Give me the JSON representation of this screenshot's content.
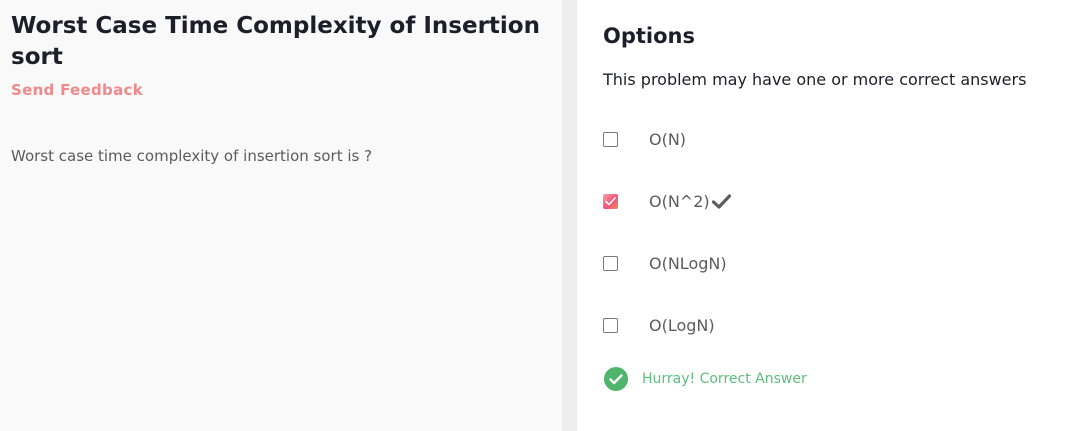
{
  "problem": {
    "title": "Worst Case Time Complexity of Insertion sort",
    "feedback_label": "Send Feedback",
    "question": "Worst case time complexity of insertion sort is ?"
  },
  "options_panel": {
    "heading": "Options",
    "note": "This problem may have one or more correct answers",
    "options": [
      {
        "label": "O(N)",
        "checked": false
      },
      {
        "label": "O(N^2)",
        "checked": true,
        "marked_correct": true
      },
      {
        "label": "O(NLogN)",
        "checked": false
      },
      {
        "label": "O(LogN)",
        "checked": false
      }
    ],
    "result_text": "Hurray! Correct Answer"
  },
  "colors": {
    "title": "#1e1e2a",
    "feedback": "#f0898a",
    "body_text": "#5c5c5c",
    "success": "#4fb56d",
    "checkbox_gradient_start": "#f7a1a6",
    "checkbox_gradient_end": "#f2537a"
  },
  "icons": {
    "checked_box": "checkmark-icon",
    "correct_tick": "check-mark-icon",
    "result": "check-circle-icon"
  }
}
